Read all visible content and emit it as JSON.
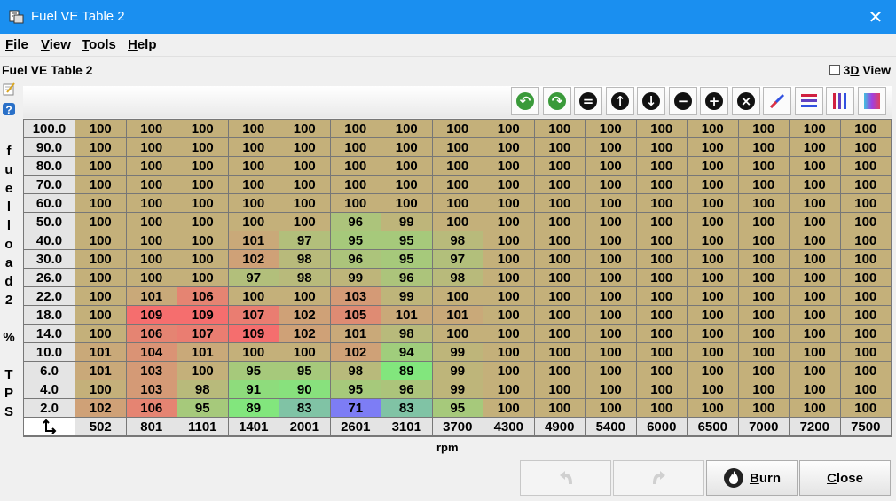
{
  "window": {
    "title": "Fuel VE Table 2",
    "close_label": "✕"
  },
  "menu": [
    {
      "mn": "F",
      "rest": "ile"
    },
    {
      "mn": "V",
      "rest": "iew"
    },
    {
      "mn": "T",
      "rest": "ools"
    },
    {
      "mn": "H",
      "rest": "elp"
    }
  ],
  "panel": {
    "title": "Fuel VE Table 2",
    "view3d_label_pre": "3",
    "view3d_label_mn": "D",
    "view3d_label_post": " View",
    "view3d_checked": false
  },
  "toolbar": {
    "buttons": [
      {
        "name": "undo-green-icon",
        "glyph": "↶",
        "color": "#3a9a3a"
      },
      {
        "name": "redo-green-icon",
        "glyph": "↷",
        "color": "#3a9a3a"
      },
      {
        "name": "set-equal-icon",
        "glyph": "=",
        "color": "#000"
      },
      {
        "name": "increment-up-icon",
        "glyph": "↑",
        "color": "#000"
      },
      {
        "name": "decrement-down-icon",
        "glyph": "↓",
        "color": "#000"
      },
      {
        "name": "subtract-icon",
        "glyph": "−",
        "color": "#000"
      },
      {
        "name": "add-icon",
        "glyph": "+",
        "color": "#000"
      },
      {
        "name": "multiply-icon",
        "glyph": "×",
        "color": "#000"
      },
      {
        "name": "interpolate-icon",
        "glyph": "",
        "color": "#000"
      },
      {
        "name": "horizontal-smooth-icon",
        "glyph": "",
        "color": "#000"
      },
      {
        "name": "vertical-smooth-icon",
        "glyph": "",
        "color": "#000"
      },
      {
        "name": "color-gradient-icon",
        "glyph": "",
        "color": "#000"
      }
    ]
  },
  "y_axis": {
    "label_chars": [
      "f",
      "u",
      "e",
      "l",
      "l",
      "o",
      "a",
      "d",
      "2",
      "",
      "%",
      "",
      "T",
      "P",
      "S"
    ]
  },
  "x_axis": {
    "label": "rpm"
  },
  "table": {
    "row_headers": [
      "100.0",
      "90.0",
      "80.0",
      "70.0",
      "60.0",
      "50.0",
      "40.0",
      "30.0",
      "26.0",
      "22.0",
      "18.0",
      "14.0",
      "10.0",
      "6.0",
      "4.0",
      "2.0"
    ],
    "col_headers": [
      "502",
      "801",
      "1101",
      "1401",
      "2001",
      "2601",
      "3101",
      "3700",
      "4300",
      "4900",
      "5400",
      "6000",
      "6500",
      "7000",
      "7200",
      "7500"
    ],
    "rows": [
      [
        "100",
        "100",
        "100",
        "100",
        "100",
        "100",
        "100",
        "100",
        "100",
        "100",
        "100",
        "100",
        "100",
        "100",
        "100",
        "100"
      ],
      [
        "100",
        "100",
        "100",
        "100",
        "100",
        "100",
        "100",
        "100",
        "100",
        "100",
        "100",
        "100",
        "100",
        "100",
        "100",
        "100"
      ],
      [
        "100",
        "100",
        "100",
        "100",
        "100",
        "100",
        "100",
        "100",
        "100",
        "100",
        "100",
        "100",
        "100",
        "100",
        "100",
        "100"
      ],
      [
        "100",
        "100",
        "100",
        "100",
        "100",
        "100",
        "100",
        "100",
        "100",
        "100",
        "100",
        "100",
        "100",
        "100",
        "100",
        "100"
      ],
      [
        "100",
        "100",
        "100",
        "100",
        "100",
        "100",
        "100",
        "100",
        "100",
        "100",
        "100",
        "100",
        "100",
        "100",
        "100",
        "100"
      ],
      [
        "100",
        "100",
        "100",
        "100",
        "100",
        "96",
        "99",
        "100",
        "100",
        "100",
        "100",
        "100",
        "100",
        "100",
        "100",
        "100"
      ],
      [
        "100",
        "100",
        "100",
        "101",
        "97",
        "95",
        "95",
        "98",
        "100",
        "100",
        "100",
        "100",
        "100",
        "100",
        "100",
        "100"
      ],
      [
        "100",
        "100",
        "100",
        "102",
        "98",
        "96",
        "95",
        "97",
        "100",
        "100",
        "100",
        "100",
        "100",
        "100",
        "100",
        "100"
      ],
      [
        "100",
        "100",
        "100",
        "97",
        "98",
        "99",
        "96",
        "98",
        "100",
        "100",
        "100",
        "100",
        "100",
        "100",
        "100",
        "100"
      ],
      [
        "100",
        "101",
        "106",
        "100",
        "100",
        "103",
        "99",
        "100",
        "100",
        "100",
        "100",
        "100",
        "100",
        "100",
        "100",
        "100"
      ],
      [
        "100",
        "109",
        "109",
        "107",
        "102",
        "105",
        "101",
        "101",
        "100",
        "100",
        "100",
        "100",
        "100",
        "100",
        "100",
        "100"
      ],
      [
        "100",
        "106",
        "107",
        "109",
        "102",
        "101",
        "98",
        "100",
        "100",
        "100",
        "100",
        "100",
        "100",
        "100",
        "100",
        "100"
      ],
      [
        "101",
        "104",
        "101",
        "100",
        "100",
        "102",
        "94",
        "99",
        "100",
        "100",
        "100",
        "100",
        "100",
        "100",
        "100",
        "100"
      ],
      [
        "101",
        "103",
        "100",
        "95",
        "95",
        "98",
        "89",
        "99",
        "100",
        "100",
        "100",
        "100",
        "100",
        "100",
        "100",
        "100"
      ],
      [
        "100",
        "103",
        "98",
        "91",
        "90",
        "95",
        "96",
        "99",
        "100",
        "100",
        "100",
        "100",
        "100",
        "100",
        "100",
        "100"
      ],
      [
        "102",
        "106",
        "95",
        "89",
        "83",
        "71",
        "83",
        "95",
        "100",
        "100",
        "100",
        "100",
        "100",
        "100",
        "100",
        "100"
      ]
    ]
  },
  "buttons": {
    "burn": {
      "mn": "B",
      "rest": "urn"
    },
    "close": {
      "mn": "C",
      "rest": "lose"
    }
  }
}
